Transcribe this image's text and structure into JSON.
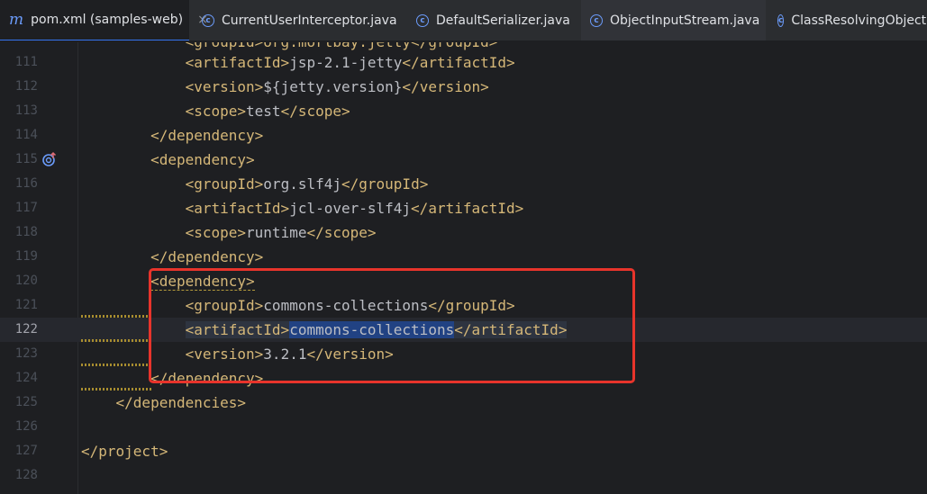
{
  "tabs": [
    {
      "name": "pom.xml (samples-web)",
      "icon": "maven-icon",
      "active": true,
      "close": "×"
    },
    {
      "name": "CurrentUserInterceptor.java",
      "icon": "class-icon"
    },
    {
      "name": "DefaultSerializer.java",
      "icon": "class-icon"
    },
    {
      "name": "ObjectInputStream.java",
      "icon": "class-icon"
    },
    {
      "name": "ClassResolvingObjectIn",
      "icon": "class-icon"
    }
  ],
  "lines": [
    {
      "n": "111",
      "indent": "            ",
      "open": "artifactId",
      "text": "jsp-2.1-jetty",
      "close": "artifactId"
    },
    {
      "n": "112",
      "indent": "            ",
      "open": "version",
      "text": "${jetty.version}",
      "close": "version"
    },
    {
      "n": "113",
      "indent": "            ",
      "open": "scope",
      "text": "test",
      "close": "scope"
    },
    {
      "n": "114",
      "indent": "        ",
      "close": "dependency"
    },
    {
      "n": "115",
      "indent": "        ",
      "open": "dependency"
    },
    {
      "n": "116",
      "indent": "            ",
      "open": "groupId",
      "text": "org.slf4j",
      "close": "groupId"
    },
    {
      "n": "117",
      "indent": "            ",
      "open": "artifactId",
      "text": "jcl-over-slf4j",
      "close": "artifactId"
    },
    {
      "n": "118",
      "indent": "            ",
      "open": "scope",
      "text": "runtime",
      "close": "scope"
    },
    {
      "n": "119",
      "indent": "        ",
      "close": "dependency"
    },
    {
      "n": "120",
      "indent": "        ",
      "open": "dependency"
    },
    {
      "n": "121",
      "indent": "            ",
      "open": "groupId",
      "text": "commons-collections",
      "close": "groupId"
    },
    {
      "n": "122",
      "indent": "            ",
      "open": "artifactId",
      "text": "commons-collections",
      "close": "artifactId"
    },
    {
      "n": "123",
      "indent": "            ",
      "open": "version",
      "text": "3.2.1",
      "close": "version"
    },
    {
      "n": "124",
      "indent": "        ",
      "close": "dependency"
    },
    {
      "n": "125",
      "indent": "    ",
      "close": "dependencies"
    },
    {
      "n": "126",
      "indent": ""
    },
    {
      "n": "127",
      "indent": "",
      "close": "project"
    },
    {
      "n": "128",
      "indent": ""
    }
  ],
  "current_line": "122",
  "colors": {
    "accent": "#3574f0",
    "tag": "#d5b778",
    "highlight": "#e8342b"
  }
}
